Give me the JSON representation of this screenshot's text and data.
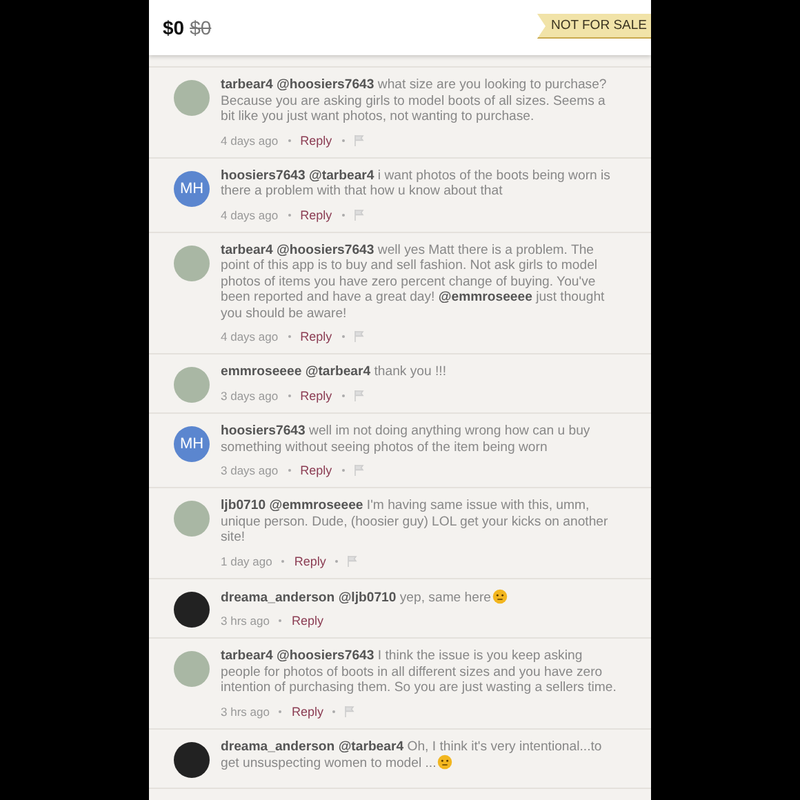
{
  "header": {
    "price": "$0",
    "original_price": "$0",
    "badge": "NOT FOR SALE"
  },
  "comments": [
    {
      "avatar": {
        "kind": "photo"
      },
      "text": "**tarbear4** **@hoosiers7643** what size are you looking to purchase? Because you are asking girls to model boots of all sizes. Seems a bit like you just want photos, not wanting to purchase.",
      "time": "4 days ago",
      "reply": "Reply",
      "flag": true,
      "emoji": false
    },
    {
      "avatar": {
        "kind": "initials",
        "initials": "MH"
      },
      "text": "**hoosiers7643** **@tarbear4** i want photos of the boots being worn is there a problem with that how u know about that",
      "time": "4 days ago",
      "reply": "Reply",
      "flag": true,
      "emoji": false
    },
    {
      "avatar": {
        "kind": "photo"
      },
      "text": "**tarbear4** **@hoosiers7643** well yes Matt there is a problem. The point of this app is to buy and sell fashion. Not ask girls to model photos of items you have zero percent change of buying. You've been reported and have a great day! **@emmroseeee** just thought you should be aware!",
      "time": "4 days ago",
      "reply": "Reply",
      "flag": true,
      "emoji": false
    },
    {
      "avatar": {
        "kind": "photo"
      },
      "text": "**emmroseeee** **@tarbear4** thank you !!!",
      "time": "3 days ago",
      "reply": "Reply",
      "flag": true,
      "emoji": false
    },
    {
      "avatar": {
        "kind": "initials",
        "initials": "MH"
      },
      "text": "**hoosiers7643** well im not doing anything wrong how can u buy something without seeing photos of the item being worn",
      "time": "3 days ago",
      "reply": "Reply",
      "flag": true,
      "emoji": false
    },
    {
      "avatar": {
        "kind": "photo"
      },
      "text": "**ljb0710** **@emmroseeee** I'm having same issue with this, umm, unique person. Dude, (hoosier guy) LOL get your kicks on another site!",
      "time": "1 day ago",
      "reply": "Reply",
      "flag": true,
      "emoji": false
    },
    {
      "avatar": {
        "kind": "dark-photo"
      },
      "text": "**dreama_anderson** **@ljb0710** yep, same here",
      "time": "3 hrs ago",
      "reply": "Reply",
      "flag": false,
      "emoji": true
    },
    {
      "avatar": {
        "kind": "photo"
      },
      "text": "**tarbear4** **@hoosiers7643** I think the issue is you keep asking people for photos of boots in all different sizes and you have zero intention of purchasing them. So you are just wasting a sellers time.",
      "time": "3 hrs ago",
      "reply": "Reply",
      "flag": true,
      "emoji": false
    },
    {
      "avatar": {
        "kind": "dark-photo"
      },
      "text": "**dreama_anderson** **@tarbear4** Oh, I think it's very intentional...to get unsuspecting women to model ...",
      "emoji": true
    }
  ]
}
